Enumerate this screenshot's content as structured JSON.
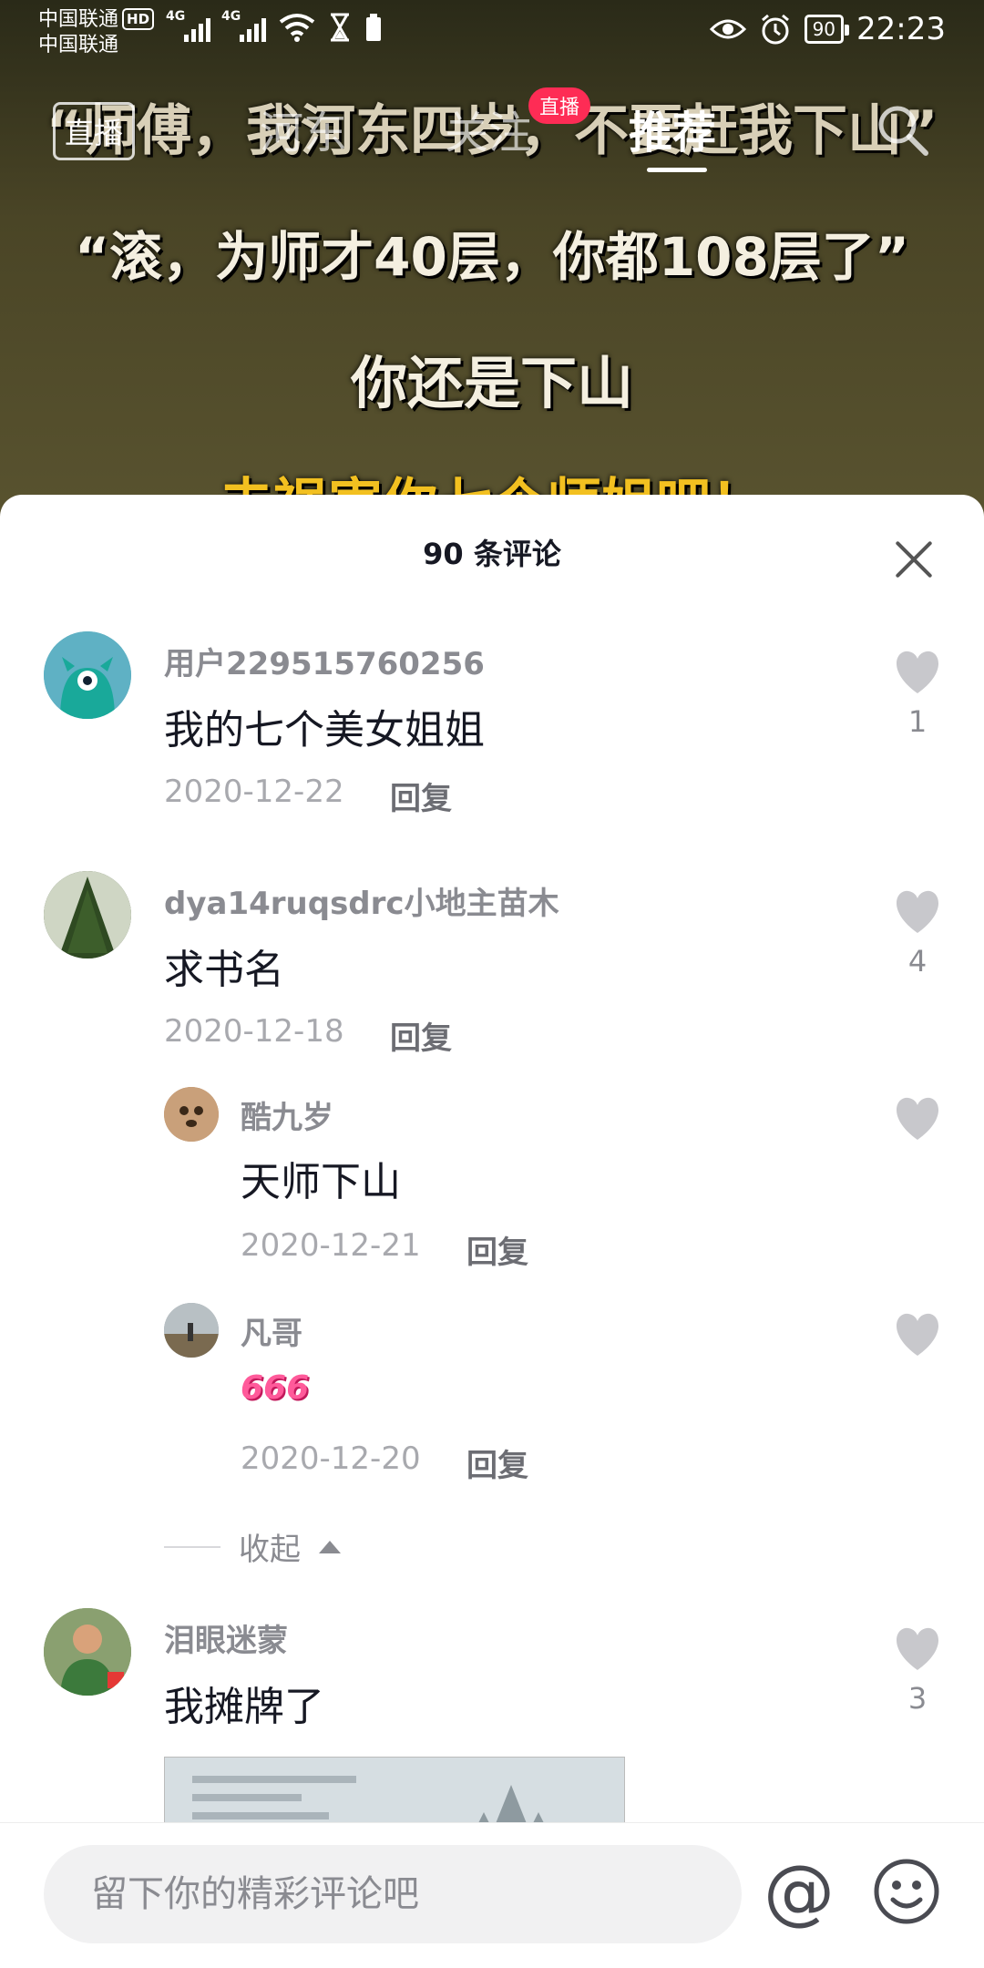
{
  "status_bar": {
    "carrier1": "中国联通",
    "carrier2": "中国联通",
    "hd": "HD",
    "net1": "4G",
    "net2": "4G",
    "battery": "90",
    "time": "22:23"
  },
  "video": {
    "caption1": "“师傅，我河东四岁，不要赶我下山”",
    "caption2": "“滚，为师才40层，你都108层了”",
    "caption3": "你还是下山",
    "caption4": "去祸害你七个师姐吧！"
  },
  "top_nav": {
    "live": "直播",
    "hedong": "河东",
    "follow": "关注",
    "follow_badge": "直播",
    "recommend": "推荐"
  },
  "comments_panel": {
    "title": "90 条评论",
    "reply_label": "回复",
    "collapse_label": "收起",
    "comments": [
      {
        "user": "用户229515760256",
        "text": "我的七个美女姐姐",
        "date": "2020-12-22",
        "likes": "1"
      },
      {
        "user": "dya14ruqsdrc小地主苗木",
        "text": "求书名",
        "date": "2020-12-18",
        "likes": "4"
      },
      {
        "user": "泪眼迷蒙",
        "text": "我摊牌了",
        "likes": "3"
      }
    ],
    "replies": [
      {
        "user": "酷九岁",
        "text": "天师下山",
        "date": "2020-12-21"
      },
      {
        "user": "凡哥",
        "text": "666",
        "date": "2020-12-20"
      }
    ]
  },
  "input": {
    "placeholder": "留下你的精彩评论吧",
    "at": "@"
  },
  "colors": {
    "accent": "#fe2c55",
    "like_gray": "#c8c8cc",
    "text_dark": "#161823"
  }
}
